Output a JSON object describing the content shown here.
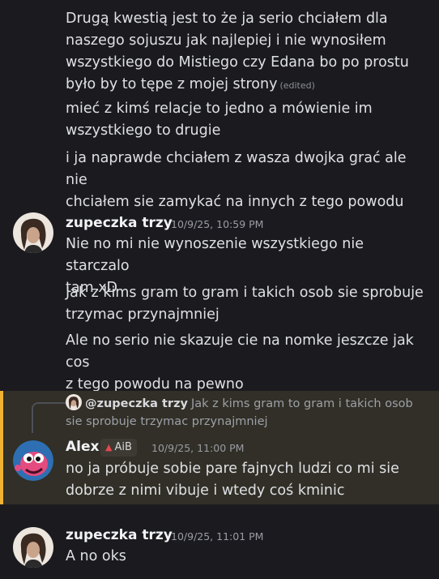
{
  "messages": {
    "m0": {
      "lines": [
        "Drugą kwestią jest to że ja serio chciałem dla",
        "naszego sojuszu jak najlepiej i nie wynosiłem",
        "wszystkiego do Mistiego czy Edana bo po prostu",
        "było by to tępe z mojej strony"
      ],
      "edited": "(edited)"
    },
    "m1": [
      "mieć z kimś relacje to jedno a mówienie im",
      "wszystkiego to drugie"
    ],
    "m2": [
      "i ja naprawde chciałem z wasza dwojka grać ale nie",
      "chciałem sie zamykać na innych z tego powodu"
    ]
  },
  "group2": {
    "username": "zupeczka trzy",
    "timestamp": "10/9/25, 10:59 PM",
    "messages": [
      [
        "Nie no mi nie wynoszenie wszystkiego nie starczalo",
        "tam xD"
      ],
      [
        "Jak z kims gram to gram i takich osob sie sprobuje",
        "trzymac przynajmniej"
      ],
      [
        "Ale no serio nie skazuje cie na nomke jeszcze jak cos",
        "z tego powodu na pewno"
      ]
    ]
  },
  "reply_msg": {
    "reply_user": "@zupeczka trzy",
    "reply_line1": "Jak z kims gram to gram i takich osob",
    "reply_line2": "sie sprobuje trzymac przynajmniej",
    "username": "Alex",
    "tag": "AiB",
    "timestamp": "10/9/25, 11:00 PM",
    "lines": [
      "no ja próbuje sobie pare fajnych ludzi co mi sie",
      "dobrze z nimi vibuje i wtedy coś kminic"
    ]
  },
  "group4": {
    "username": "zupeczka trzy",
    "timestamp": "10/9/25, 11:01 PM",
    "message": "A no oks"
  },
  "colors": {
    "background": "#1b1b1f",
    "mention_highlight": "#312f27",
    "mention_bar": "#f0b232"
  }
}
